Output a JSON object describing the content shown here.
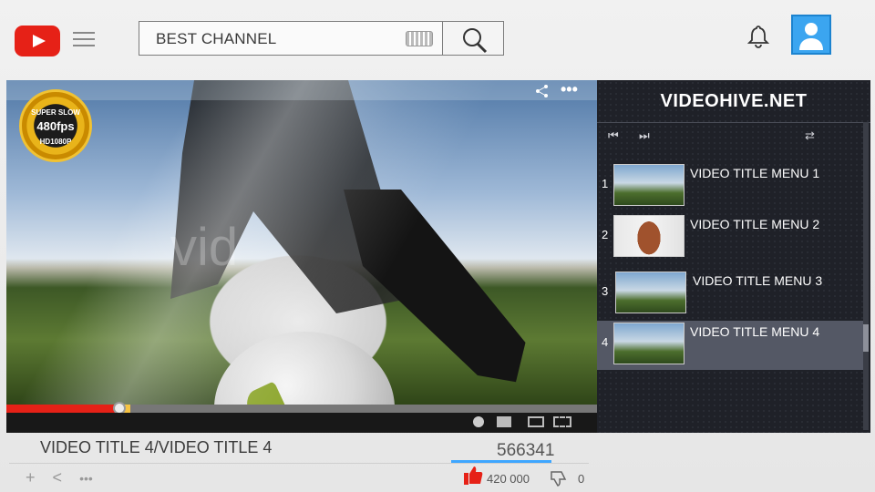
{
  "header": {
    "search_value": "BEST CHANNEL",
    "icons": [
      "youtube-logo",
      "hamburger-menu-icon",
      "keyboard-icon",
      "search-icon",
      "bell-icon",
      "user-avatar-icon"
    ]
  },
  "video": {
    "watermark": "vid",
    "badge": {
      "line1": "SUPER SLOW",
      "line2": "480fps",
      "line3": "HD1080P"
    },
    "progress_played": 0.19,
    "progress_buffered": 0.21
  },
  "playlist": {
    "title": "VIDEOHIVE.NET",
    "items": [
      {
        "num": "1",
        "label": "VIDEO TITLE MENU 1",
        "selected": false
      },
      {
        "num": "2",
        "label": "VIDEO TITLE MENU 2",
        "selected": false
      },
      {
        "num": "3",
        "label": "VIDEO TITLE MENU 3",
        "selected": false
      },
      {
        "num": "4",
        "label": "VIDEO TITLE MENU 4",
        "selected": true
      }
    ]
  },
  "info": {
    "title": "VIDEO TITLE 4/VIDEO TITLE 4",
    "views": "566341",
    "likes": "420 000",
    "dislikes": "0"
  },
  "colors": {
    "brand_red": "#e62117",
    "accent_blue": "#3ea6ff",
    "panel_dark": "#1f2128"
  }
}
